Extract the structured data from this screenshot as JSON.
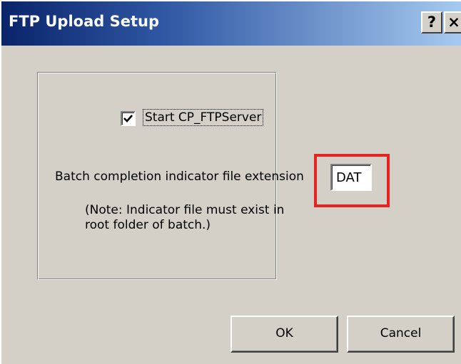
{
  "window": {
    "title": "FTP Upload Setup",
    "help_glyph": "?",
    "close_glyph": "×"
  },
  "options": {
    "start_server_label": "Start CP_FTPServer",
    "start_server_checked": true,
    "extension_label": "Batch completion indicator file extension",
    "extension_value": "DAT",
    "note_line1": "(Note: Indicator file must exist in",
    "note_line2": "root folder of batch.)"
  },
  "buttons": {
    "ok_label": "OK",
    "cancel_label": "Cancel"
  },
  "colors": {
    "titlebar_start": "#0a246a",
    "titlebar_end": "#a6caf0",
    "dialog_face": "#d4d0c8",
    "highlight_box": "#e8221e"
  },
  "icons": {
    "help": "question-mark-icon",
    "close": "close-icon",
    "check": "checkmark-icon"
  }
}
